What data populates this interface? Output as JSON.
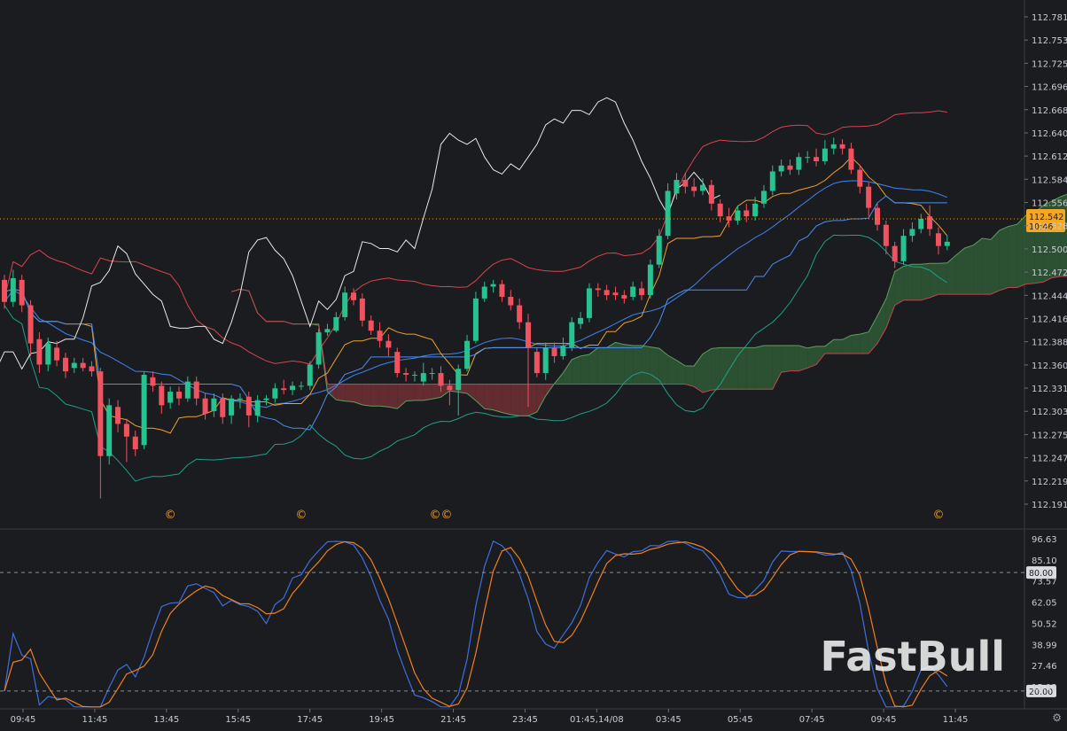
{
  "watermark": "FastBull",
  "settings_icon": "gear-icon",
  "colors": {
    "background": "#1b1c20",
    "bull": "#26c290",
    "bear": "#f0525f",
    "last_price_bg": "#f5a623"
  },
  "chart_data": [
    {
      "type": "candlestick",
      "panel": "main",
      "ylim": [
        112.177,
        112.792
      ],
      "y_ticks": [
        "112.781",
        "112.753",
        "112.725",
        "112.696",
        "112.668",
        "112.640",
        "112.612",
        "112.584",
        "112.556",
        "112.528",
        "112.500",
        "112.472",
        "112.444",
        "112.416",
        "112.388",
        "112.360",
        "112.331",
        "112.303",
        "112.275",
        "112.247",
        "112.219",
        "112.191"
      ],
      "last_price": {
        "value": 112.542,
        "label": "112.542",
        "sub_label": "10:46"
      },
      "series_names": [
        "candles",
        "ichimoku cloud",
        "bollinger bands",
        "moving averages"
      ],
      "events": [
        {
          "x": 19,
          "label": "©"
        },
        {
          "x": 34,
          "label": "©"
        },
        {
          "x": 50,
          "label": "©©"
        },
        {
          "x": 107,
          "label": "©"
        }
      ],
      "candles": [
        [
          112.47,
          112.444,
          112.476,
          112.436
        ],
        [
          112.444,
          112.472,
          112.482,
          112.438
        ],
        [
          112.47,
          112.44,
          112.476,
          112.432
        ],
        [
          112.44,
          112.395,
          112.446,
          112.38
        ],
        [
          112.4,
          112.37,
          112.408,
          112.36
        ],
        [
          112.37,
          112.395,
          112.402,
          112.362
        ],
        [
          112.39,
          112.375,
          112.398,
          112.368
        ],
        [
          112.378,
          112.362,
          112.384,
          112.354
        ],
        [
          112.366,
          112.372,
          112.378,
          112.36
        ],
        [
          112.372,
          112.366,
          112.378,
          112.362
        ],
        [
          112.368,
          112.362,
          112.374,
          112.356
        ],
        [
          112.362,
          112.262,
          112.366,
          112.212
        ],
        [
          112.262,
          112.322,
          112.33,
          112.252
        ],
        [
          112.32,
          112.3,
          112.328,
          112.29
        ],
        [
          112.3,
          112.285,
          112.306,
          112.255
        ],
        [
          112.285,
          112.27,
          112.292,
          112.262
        ],
        [
          112.275,
          112.358,
          112.362,
          112.27
        ],
        [
          112.355,
          112.345,
          112.362,
          112.338
        ],
        [
          112.345,
          112.322,
          112.35,
          112.312
        ],
        [
          112.325,
          112.338,
          112.344,
          112.318
        ],
        [
          112.338,
          112.33,
          112.344,
          112.322
        ],
        [
          112.33,
          112.35,
          112.356,
          112.326
        ],
        [
          112.35,
          112.33,
          112.356,
          112.322
        ],
        [
          112.33,
          112.312,
          112.336,
          112.305
        ],
        [
          112.315,
          112.33,
          112.336,
          112.308
        ],
        [
          112.33,
          112.308,
          112.336,
          112.3
        ],
        [
          112.31,
          112.33,
          112.334,
          112.3
        ],
        [
          112.33,
          112.33,
          112.336,
          112.318
        ],
        [
          112.332,
          112.31,
          112.338,
          112.296
        ],
        [
          112.31,
          112.328,
          112.334,
          112.302
        ],
        [
          112.328,
          112.33,
          112.334,
          112.322
        ],
        [
          112.33,
          112.342,
          112.348,
          112.325
        ],
        [
          112.342,
          112.34,
          112.352,
          112.335
        ],
        [
          112.34,
          112.345,
          112.35,
          112.334
        ],
        [
          112.345,
          112.345,
          112.35,
          112.34
        ],
        [
          112.345,
          112.37,
          112.374,
          112.34
        ],
        [
          112.37,
          112.408,
          112.412,
          112.365
        ],
        [
          112.408,
          112.412,
          112.418,
          112.404
        ],
        [
          112.41,
          112.426,
          112.432,
          112.408
        ],
        [
          112.426,
          112.455,
          112.462,
          112.422
        ],
        [
          112.455,
          112.446,
          112.46,
          112.44
        ],
        [
          112.448,
          112.422,
          112.454,
          112.415
        ],
        [
          112.422,
          112.41,
          112.428,
          112.405
        ],
        [
          112.41,
          112.398,
          112.42,
          112.39
        ],
        [
          112.398,
          112.39,
          112.406,
          112.38
        ],
        [
          112.385,
          112.36,
          112.39,
          112.355
        ],
        [
          112.36,
          112.358,
          112.366,
          112.35
        ],
        [
          112.358,
          112.358,
          112.362,
          112.35
        ],
        [
          112.35,
          112.36,
          112.372,
          112.345
        ],
        [
          112.36,
          112.36,
          112.366,
          112.352
        ],
        [
          112.36,
          112.345,
          112.368,
          112.338
        ],
        [
          112.345,
          112.34,
          112.352,
          112.322
        ],
        [
          112.34,
          112.365,
          112.37,
          112.31
        ],
        [
          112.365,
          112.398,
          112.405,
          112.362
        ],
        [
          112.398,
          112.448,
          112.456,
          112.395
        ],
        [
          112.448,
          112.462,
          112.468,
          112.444
        ],
        [
          112.462,
          112.465,
          112.47,
          112.455
        ],
        [
          112.465,
          112.45,
          112.47,
          112.444
        ],
        [
          112.45,
          112.44,
          112.458,
          112.434
        ],
        [
          112.44,
          112.42,
          112.448,
          112.412
        ],
        [
          112.42,
          112.39,
          112.43,
          112.32
        ],
        [
          112.385,
          112.36,
          112.39,
          112.355
        ],
        [
          112.36,
          112.39,
          112.396,
          112.352
        ],
        [
          112.39,
          112.38,
          112.396,
          112.372
        ],
        [
          112.38,
          112.392,
          112.402,
          112.376
        ],
        [
          112.39,
          112.42,
          112.426,
          112.386
        ],
        [
          112.418,
          112.425,
          112.432,
          112.412
        ],
        [
          112.425,
          112.46,
          112.466,
          112.42
        ],
        [
          112.46,
          112.458,
          112.466,
          112.45
        ],
        [
          112.458,
          112.452,
          112.464,
          112.446
        ],
        [
          112.455,
          112.452,
          112.462,
          112.446
        ],
        [
          112.452,
          112.448,
          112.458,
          112.442
        ],
        [
          112.45,
          112.462,
          112.468,
          112.446
        ],
        [
          112.46,
          112.452,
          112.468,
          112.446
        ],
        [
          112.452,
          112.488,
          112.494,
          112.448
        ],
        [
          112.488,
          112.522,
          112.53,
          112.484
        ],
        [
          112.522,
          112.575,
          112.584,
          112.518
        ],
        [
          112.572,
          112.588,
          112.596,
          112.565
        ],
        [
          112.588,
          112.58,
          112.596,
          112.572
        ],
        [
          112.58,
          112.575,
          112.59,
          112.568
        ],
        [
          112.575,
          112.582,
          112.59,
          112.57
        ],
        [
          112.582,
          112.56,
          112.588,
          112.552
        ],
        [
          112.56,
          112.545,
          112.565,
          112.538
        ],
        [
          112.545,
          112.54,
          112.555,
          112.532
        ],
        [
          112.54,
          112.552,
          112.558,
          112.535
        ],
        [
          112.552,
          112.545,
          112.56,
          112.538
        ],
        [
          112.545,
          112.56,
          112.568,
          112.54
        ],
        [
          112.56,
          112.575,
          112.582,
          112.555
        ],
        [
          112.575,
          112.598,
          112.605,
          112.57
        ],
        [
          112.598,
          112.605,
          112.612,
          112.592
        ],
        [
          112.605,
          112.6,
          112.612,
          112.594
        ],
        [
          112.6,
          112.615,
          112.62,
          112.594
        ],
        [
          112.615,
          112.615,
          112.622,
          112.608
        ],
        [
          112.615,
          112.61,
          112.625,
          112.604
        ],
        [
          112.61,
          112.625,
          112.635,
          112.606
        ],
        [
          112.625,
          112.63,
          112.638,
          112.618
        ],
        [
          112.63,
          112.625,
          112.636,
          112.618
        ],
        [
          112.625,
          112.6,
          112.632,
          112.595
        ],
        [
          112.6,
          112.58,
          112.606,
          112.572
        ],
        [
          112.58,
          112.555,
          112.585,
          112.545
        ],
        [
          112.555,
          112.535,
          112.56,
          112.528
        ],
        [
          112.535,
          112.51,
          112.54,
          112.5
        ],
        [
          112.51,
          112.492,
          112.515,
          112.484
        ],
        [
          112.492,
          112.522,
          112.53,
          112.488
        ],
        [
          112.522,
          112.53,
          112.538,
          112.515
        ],
        [
          112.53,
          112.542,
          112.548,
          112.525
        ],
        [
          112.545,
          112.53,
          112.558,
          112.522
        ],
        [
          112.525,
          112.51,
          112.532,
          112.5
        ],
        [
          112.51,
          112.515,
          112.522,
          112.505
        ]
      ]
    },
    {
      "type": "line",
      "panel": "stochastic oscillator",
      "ylim": [
        11.0,
        102.0
      ],
      "y_ticks": [
        "96.63",
        "85.10",
        "73.57",
        "62.05",
        "50.52",
        "38.99",
        "27.46",
        "15.93"
      ],
      "levels": [
        {
          "value": 80.0,
          "label": "80.00"
        },
        {
          "value": 20.0,
          "label": "20.00"
        }
      ],
      "x_ticks": [
        "09:45",
        "11:45",
        "13:45",
        "15:45",
        "17:45",
        "19:45",
        "21:45",
        "23:45",
        "01:45,14/08",
        "03:45",
        "05:45",
        "07:45",
        "09:45",
        "11:45"
      ]
    }
  ]
}
